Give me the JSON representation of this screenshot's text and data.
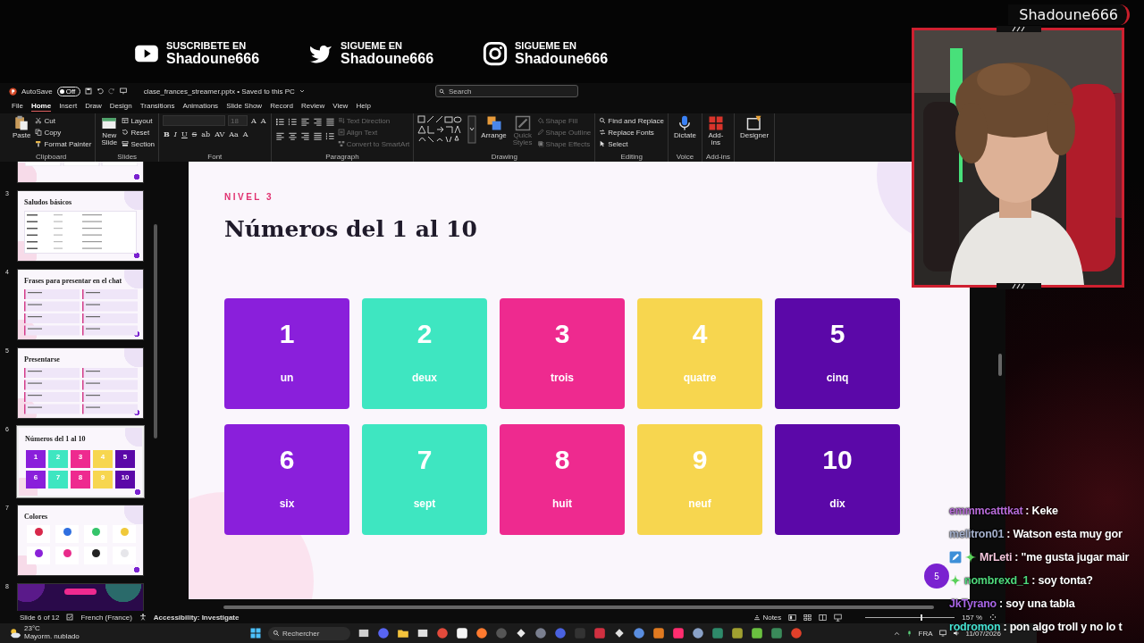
{
  "stream_banner": [
    {
      "caption": "SUSCRIBETE EN",
      "handle": "Shadoune666"
    },
    {
      "caption": "SIGUEME EN",
      "handle": "Shadoune666"
    },
    {
      "caption": "SIGUEME EN",
      "handle": "Shadoune666"
    }
  ],
  "name_tag": "Shadoune666",
  "title_bar": {
    "autosave_label": "AutoSave",
    "autosave": {
      "label": "Off",
      "on": false
    },
    "file_name": "clase_frances_streamer.pptx • Saved to this PC",
    "search": {
      "placeholder": "Search"
    }
  },
  "menu_tabs": [
    {
      "label": "File",
      "selected": false
    },
    {
      "label": "Home",
      "selected": true
    },
    {
      "label": "Insert",
      "selected": false
    },
    {
      "label": "Draw",
      "selected": false
    },
    {
      "label": "Design",
      "selected": false
    },
    {
      "label": "Transitions",
      "selected": false
    },
    {
      "label": "Animations",
      "selected": false
    },
    {
      "label": "Slide Show",
      "selected": false
    },
    {
      "label": "Record",
      "selected": false
    },
    {
      "label": "Review",
      "selected": false
    },
    {
      "label": "View",
      "selected": false
    },
    {
      "label": "Help",
      "selected": false
    }
  ],
  "ribbon": {
    "groups": [
      {
        "kind": "standard",
        "label": "Clipboard",
        "items": [
          {
            "label": "Paste",
            "kind": "large",
            "disabled": false
          },
          {
            "label": "Cut",
            "kind": "small",
            "disabled": false
          },
          {
            "label": "Copy",
            "kind": "small",
            "disabled": false
          },
          {
            "label": "Format Painter",
            "kind": "small",
            "disabled": false
          }
        ]
      },
      {
        "kind": "standard",
        "label": "Slides",
        "items": [
          {
            "label": "New Slide",
            "kind": "large",
            "disabled": false
          },
          {
            "label": "Layout",
            "kind": "small",
            "disabled": false
          },
          {
            "label": "Reset",
            "kind": "small",
            "disabled": false
          },
          {
            "label": "Section",
            "kind": "small",
            "disabled": false
          }
        ]
      },
      {
        "kind": "font",
        "label": "Font",
        "font_size": {
          "value": "18",
          "disabled": true
        },
        "size_buttons": [
          "A",
          "A"
        ],
        "format_buttons": [
          "B",
          "I",
          "U",
          "S",
          "ab",
          "AV",
          "Aa",
          "A"
        ]
      },
      {
        "kind": "paragraph",
        "label": "Paragraph",
        "items": [
          {
            "label": "Text Direction",
            "kind": "small",
            "disabled": true
          },
          {
            "label": "Align Text",
            "kind": "small",
            "disabled": true
          },
          {
            "label": "Convert to SmartArt",
            "kind": "small",
            "disabled": true
          }
        ]
      },
      {
        "kind": "drawing",
        "label": "Drawing",
        "items": [
          {
            "label": "Arrange",
            "kind": "large",
            "disabled": false
          },
          {
            "label": "Quick Styles",
            "kind": "large",
            "disabled": true
          },
          {
            "label": "Shape Fill",
            "kind": "small",
            "disabled": true
          },
          {
            "label": "Shape Outline",
            "kind": "small",
            "disabled": true
          },
          {
            "label": "Shape Effects",
            "kind": "small",
            "disabled": true
          }
        ]
      },
      {
        "kind": "standard",
        "label": "Editing",
        "items": [
          {
            "label": "Find and Replace",
            "kind": "small",
            "disabled": false
          },
          {
            "label": "Replace Fonts",
            "kind": "small",
            "disabled": false
          },
          {
            "label": "Select",
            "kind": "small",
            "disabled": false
          }
        ]
      },
      {
        "kind": "standard",
        "label": "Voice",
        "items": [
          {
            "label": "Dictate",
            "kind": "large",
            "disabled": false
          }
        ]
      },
      {
        "kind": "standard",
        "label": "Add-ins",
        "items": [
          {
            "label": "Add-ins",
            "kind": "large",
            "disabled": false
          }
        ]
      },
      {
        "kind": "standard",
        "items": [
          {
            "label": "Designer",
            "kind": "large",
            "disabled": false
          }
        ]
      }
    ]
  },
  "thumbnails": [
    {
      "kind": "cards",
      "selected": false
    },
    {
      "number": "3",
      "kind": "table",
      "title": "Saludos básicos",
      "selected": false
    },
    {
      "number": "4",
      "kind": "list",
      "title": "Frases para presentar en el chat",
      "selected": false
    },
    {
      "number": "5",
      "kind": "list",
      "title": "Presentarse",
      "selected": false
    },
    {
      "number": "6",
      "kind": "tiles",
      "title": "Números del 1 al 10",
      "selected": true,
      "tiles": [
        {
          "number": "1",
          "color": "#8a1fdb"
        },
        {
          "number": "2",
          "color": "#3ee6c1"
        },
        {
          "number": "3",
          "color": "#ee2a8f"
        },
        {
          "number": "4",
          "color": "#f7d64f"
        },
        {
          "number": "5",
          "color": "#5b08a8"
        },
        {
          "number": "6",
          "color": "#8a1fdb"
        },
        {
          "number": "7",
          "color": "#3ee6c1"
        },
        {
          "number": "8",
          "color": "#ee2a8f"
        },
        {
          "number": "9",
          "color": "#f7d64f"
        },
        {
          "number": "10",
          "color": "#5b08a8"
        }
      ]
    },
    {
      "number": "7",
      "kind": "colors",
      "title": "Colores",
      "selected": false,
      "swatches": [
        {
          "color": "#d8284a"
        },
        {
          "color": "#2f6fe0"
        },
        {
          "color": "#35c46a"
        },
        {
          "color": "#f0c93a"
        },
        {
          "color": "#8a22d8"
        },
        {
          "color": "#e82a8a"
        },
        {
          "color": "#222222"
        },
        {
          "color": "#e6e6ea"
        }
      ]
    },
    {
      "number": "8",
      "kind": "cover",
      "selected": false
    }
  ],
  "slide": {
    "level_label": "NIVEL 3",
    "title": "Números del 1 al 10",
    "page_badge": "5",
    "tiles": [
      {
        "number": "1",
        "word": "un",
        "color": "#8a1fdb"
      },
      {
        "number": "2",
        "word": "deux",
        "color": "#3ee6c1"
      },
      {
        "number": "3",
        "word": "trois",
        "color": "#ee2a8f"
      },
      {
        "number": "4",
        "word": "quatre",
        "color": "#f7d64f"
      },
      {
        "number": "5",
        "word": "cinq",
        "color": "#5b08a8"
      },
      {
        "number": "6",
        "word": "six",
        "color": "#8a1fdb"
      },
      {
        "number": "7",
        "word": "sept",
        "color": "#3ee6c1"
      },
      {
        "number": "8",
        "word": "huit",
        "color": "#ee2a8f"
      },
      {
        "number": "9",
        "word": "neuf",
        "color": "#f7d64f"
      },
      {
        "number": "10",
        "word": "dix",
        "color": "#5b08a8"
      }
    ]
  },
  "status_bar": {
    "slide_info": "Slide 6 of 12",
    "language": "French (France)",
    "accessibility": "Accessibility: Investigate",
    "notes": "Notes",
    "zoom": {
      "level": 0.62,
      "reading": "157 %"
    }
  },
  "taskbar": {
    "weather": {
      "temperature": "23°C",
      "condition": "Mayorm. nublado"
    },
    "search": {
      "placeholder": "Rechercher"
    },
    "language": "FRA",
    "date": "11/07/2026"
  },
  "chat": [
    {
      "user": "emmmcatttkat",
      "color": "#b56ad6",
      "message": ": Keke"
    },
    {
      "user": "melitron01",
      "color": "#a4b0cc",
      "message": ": Watson esta muy gor"
    },
    {
      "user": "MrLeti",
      "color": "#f2c4da",
      "message": ": \"me gusta jugar mair",
      "badges": [
        {
          "kind": "pen"
        },
        {
          "kind": "diamond"
        }
      ]
    },
    {
      "user": "nombrexd_1",
      "color": "#4fd97c",
      "message": ": soy tonta?",
      "badges": [
        {
          "kind": "diamond"
        }
      ]
    },
    {
      "user": "JkTyrano",
      "color": "#a866e6",
      "message": ": soy una tabla"
    },
    {
      "user": "rodromon",
      "color": "#46e2d2",
      "message": ": pon algo troll y no lo t"
    }
  ]
}
